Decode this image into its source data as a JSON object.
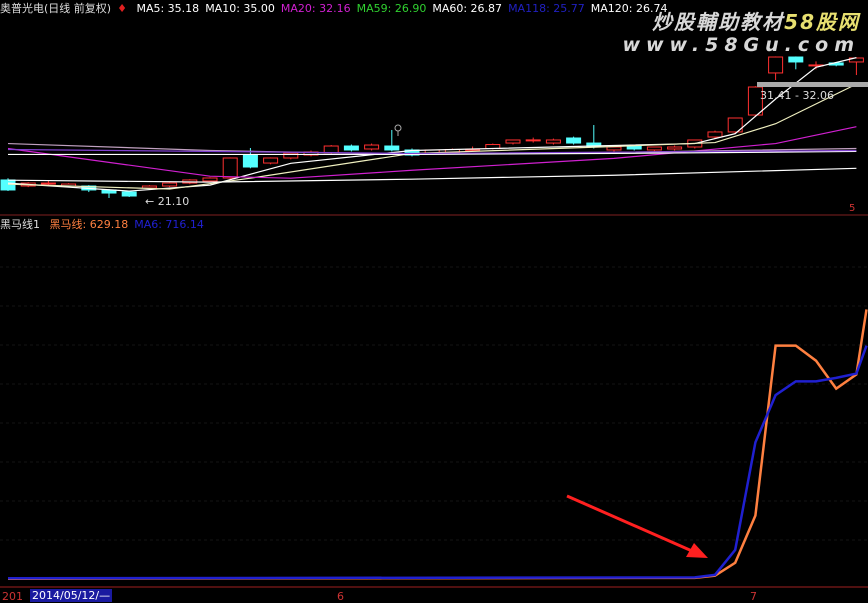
{
  "header": {
    "stock": "奥普光电(日线 前复权)",
    "ma": [
      {
        "label": "MA5: 35.18",
        "color": "#ffffff"
      },
      {
        "label": "MA10: 35.00",
        "color": "#ffffff"
      },
      {
        "label": "MA20: 32.16",
        "color": "#d020d0"
      },
      {
        "label": "MA59: 26.90",
        "color": "#30d030"
      },
      {
        "label": "MA60: 26.87",
        "color": "#ffffff"
      },
      {
        "label": "MA118: 25.77",
        "color": "#2020c0"
      },
      {
        "label": "MA120: 26.74",
        "color": "#ffffff"
      }
    ]
  },
  "watermark": {
    "line1": "炒股輔助教材",
    "line1b": "58股网",
    "line2": "www.58Gu.com"
  },
  "indicator": {
    "name": "黑马线1",
    "items": [
      {
        "label": "黑马线: 629.18",
        "color": "#ff8040"
      },
      {
        "label": "MA6: 716.14",
        "color": "#2020d0"
      }
    ]
  },
  "annotations": {
    "range": "31.41 - 32.06",
    "low": "← 21.10",
    "right_marker": "5"
  },
  "axis": {
    "start": "201",
    "date": "2014/05/12/—",
    "month6": "6",
    "month7": "7"
  },
  "chart_data": [
    {
      "type": "candlestick",
      "title": "奥普光电(日线 前复权)",
      "ylim": [
        20.5,
        37.5
      ],
      "candles": [
        [
          22.82,
          23.0,
          21.7,
          21.81
        ],
        [
          22.21,
          22.6,
          22.1,
          22.51
        ],
        [
          22.5,
          22.8,
          22.2,
          22.51
        ],
        [
          22.21,
          22.5,
          22.1,
          22.41
        ],
        [
          22.21,
          22.3,
          21.6,
          21.81
        ],
        [
          21.81,
          21.9,
          21.0,
          21.5
        ],
        [
          21.61,
          21.7,
          21.1,
          21.2
        ],
        [
          22.01,
          22.3,
          21.9,
          22.21
        ],
        [
          22.21,
          22.6,
          22.1,
          22.51
        ],
        [
          22.51,
          22.9,
          22.4,
          22.82
        ],
        [
          22.72,
          23.1,
          22.6,
          23.02
        ],
        [
          23.02,
          25.1,
          22.9,
          25.04
        ],
        [
          25.34,
          26.05,
          24.0,
          24.13
        ],
        [
          24.53,
          25.1,
          24.4,
          25.04
        ],
        [
          25.04,
          25.6,
          24.9,
          25.54
        ],
        [
          25.34,
          25.8,
          25.2,
          25.65
        ],
        [
          25.54,
          26.35,
          25.4,
          26.25
        ],
        [
          26.25,
          26.4,
          25.7,
          25.85
        ],
        [
          25.95,
          26.5,
          25.8,
          26.35
        ],
        [
          26.25,
          27.87,
          25.7,
          25.85
        ],
        [
          25.85,
          26.0,
          25.2,
          25.34
        ],
        [
          25.54,
          25.9,
          25.4,
          25.85
        ],
        [
          25.6,
          26.0,
          25.5,
          25.9
        ],
        [
          25.9,
          26.2,
          25.7,
          25.91
        ],
        [
          26.0,
          26.5,
          25.9,
          26.4
        ],
        [
          26.55,
          26.9,
          26.4,
          26.86
        ],
        [
          26.86,
          27.1,
          26.6,
          26.87
        ],
        [
          26.55,
          27.0,
          26.4,
          26.86
        ],
        [
          27.06,
          27.2,
          26.4,
          26.55
        ],
        [
          26.55,
          28.37,
          26.0,
          26.15
        ],
        [
          25.85,
          26.2,
          25.7,
          26.15
        ],
        [
          26.25,
          26.4,
          25.8,
          25.95
        ],
        [
          25.85,
          26.2,
          25.7,
          26.15
        ],
        [
          25.95,
          26.3,
          25.8,
          26.15
        ],
        [
          26.15,
          26.9,
          26.0,
          26.86
        ],
        [
          27.16,
          27.8,
          27.0,
          27.67
        ],
        [
          27.67,
          29.1,
          27.5,
          29.08
        ],
        [
          29.38,
          32.3,
          29.2,
          32.21
        ],
        [
          33.63,
          35.3,
          32.92,
          35.24
        ],
        [
          35.24,
          35.3,
          34.0,
          34.74
        ],
        [
          34.43,
          34.8,
          34.0,
          34.44
        ],
        [
          34.64,
          34.7,
          34.3,
          34.43
        ],
        [
          34.74,
          35.2,
          33.42,
          35.14
        ]
      ],
      "series": [
        {
          "name": "MA5",
          "color": "#ffffff",
          "points": [
            [
              0,
              22.5
            ],
            [
              6,
              21.7
            ],
            [
              10,
              22.3
            ],
            [
              14,
              24.5
            ],
            [
              20,
              25.8
            ],
            [
              30,
              26.3
            ],
            [
              34,
              26.5
            ],
            [
              36,
              27.5
            ],
            [
              38,
              31
            ],
            [
              40,
              34.2
            ],
            [
              42,
              35.18
            ]
          ]
        },
        {
          "name": "MA10",
          "color": "#f0f0c0",
          "points": [
            [
              0,
              22.4
            ],
            [
              8,
              21.9
            ],
            [
              12,
              23
            ],
            [
              20,
              25.5
            ],
            [
              30,
              26.2
            ],
            [
              35,
              26.6
            ],
            [
              38,
              28.5
            ],
            [
              42,
              32.5
            ]
          ]
        },
        {
          "name": "MA20",
          "color": "#d020d0",
          "points": [
            [
              0,
              26
            ],
            [
              10,
              23.2
            ],
            [
              14,
              23.0
            ],
            [
              20,
              23.8
            ],
            [
              30,
              25
            ],
            [
              38,
              26.5
            ],
            [
              42,
              28.2
            ]
          ]
        },
        {
          "name": "MA59",
          "color": "#c0a0c0",
          "points": [
            [
              0,
              26.5
            ],
            [
              10,
              25.8
            ],
            [
              20,
              25.4
            ],
            [
              30,
              25.6
            ],
            [
              42,
              26.0
            ]
          ]
        },
        {
          "name": "MA60",
          "color": "#ffffff",
          "points": [
            [
              0,
              25.4
            ],
            [
              20,
              25.4
            ],
            [
              30,
              25.5
            ],
            [
              42,
              25.7
            ]
          ]
        },
        {
          "name": "MA118",
          "color": "#8040d0",
          "points": [
            [
              0,
              25.9
            ],
            [
              20,
              25.5
            ],
            [
              42,
              25.8
            ]
          ]
        },
        {
          "name": "MA120",
          "color": "#ffffff",
          "points": [
            [
              0,
              22.8
            ],
            [
              10,
              22.6
            ],
            [
              20,
              22.9
            ],
            [
              30,
              23.3
            ],
            [
              42,
              24.0
            ]
          ]
        }
      ]
    },
    {
      "type": "line",
      "title": "黑马线1",
      "ylim": [
        0,
        830
      ],
      "series": [
        {
          "name": "黑马线",
          "color": "#ff8040",
          "points": [
            [
              0,
              3
            ],
            [
              34,
              5
            ],
            [
              35,
              10
            ],
            [
              36,
              40
            ],
            [
              37,
              150
            ],
            [
              38,
              545
            ],
            [
              39,
              545
            ],
            [
              40,
              510
            ],
            [
              41,
              445
            ],
            [
              42,
              478
            ],
            [
              42.5,
              629.18
            ]
          ]
        },
        {
          "name": "MA6",
          "color": "#2020d0",
          "points": [
            [
              0,
              4
            ],
            [
              34,
              6
            ],
            [
              35,
              12
            ],
            [
              36,
              70
            ],
            [
              37,
              320
            ],
            [
              38,
              430
            ],
            [
              39,
              462
            ],
            [
              40,
              462
            ],
            [
              41,
              470
            ],
            [
              42,
              480
            ],
            [
              42.5,
              545
            ]
          ]
        }
      ]
    }
  ],
  "colors": {
    "up": "#ff3030",
    "down": "#54ffff",
    "arrow": "#ff2020"
  }
}
